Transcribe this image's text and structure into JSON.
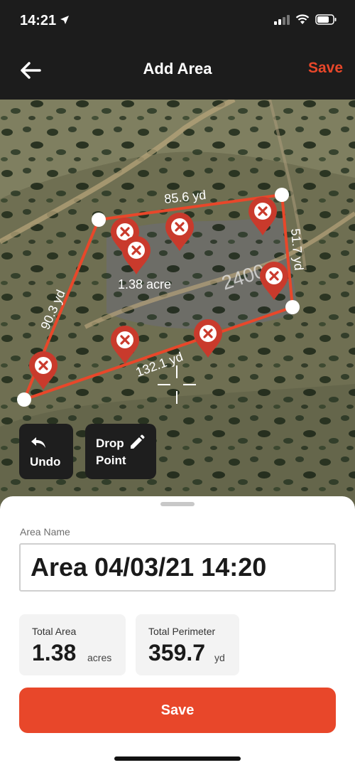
{
  "status_bar": {
    "time": "14:21"
  },
  "header": {
    "title": "Add Area",
    "save_label": "Save"
  },
  "map": {
    "background_label": "2400",
    "segment_labels": [
      "85.6 yd",
      "51.7 yd",
      "132.1 yd",
      "90.3 yd"
    ],
    "area_label": "1.38 acre",
    "undo_label": "Undo",
    "drop_label_line1": "Drop",
    "drop_label_line2": "Point",
    "polygon_color": "#e8472a",
    "marker_color": "#c93a2c"
  },
  "form": {
    "area_name_label": "Area Name",
    "area_name_value": "Area 04/03/21 14:20"
  },
  "stats": {
    "total_area": {
      "label": "Total Area",
      "value": "1.38",
      "unit": "acres"
    },
    "total_perimeter": {
      "label": "Total Perimeter",
      "value": "359.7",
      "unit": "yd"
    }
  },
  "save_button_label": "Save",
  "colors": {
    "accent": "#e8472a",
    "header_bg": "#1c1c1c"
  }
}
